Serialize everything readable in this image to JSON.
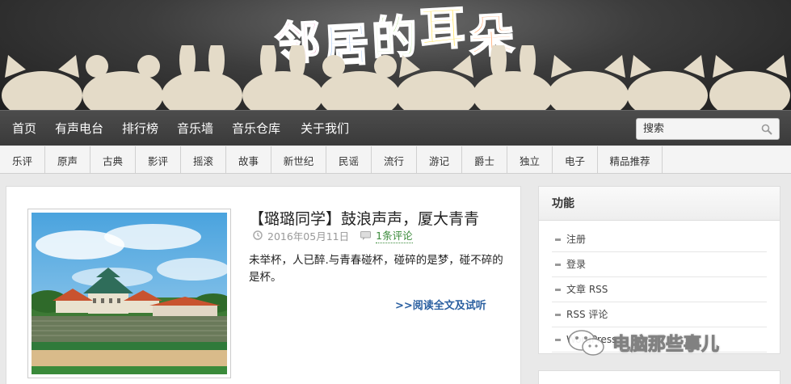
{
  "site": {
    "logo_text": "邻居的耳朵"
  },
  "nav": {
    "items": [
      {
        "label": "首页"
      },
      {
        "label": "有声电台"
      },
      {
        "label": "排行榜"
      },
      {
        "label": "音乐墙"
      },
      {
        "label": "音乐仓库"
      },
      {
        "label": "关于我们"
      }
    ],
    "search_placeholder": "搜索"
  },
  "categories": [
    "乐评",
    "原声",
    "古典",
    "影评",
    "摇滚",
    "故事",
    "新世纪",
    "民谣",
    "流行",
    "游记",
    "爵士",
    "独立",
    "电子",
    "精品推荐"
  ],
  "post": {
    "title": "【璐璐同学】鼓浪声声，厦大青青",
    "date": "2016年05月11日",
    "comments": "1条评论",
    "excerpt": "未举杯，人已醉.与青春碰杯，碰碎的是梦，碰不碎的是杯。",
    "read_more": ">>阅读全文及试听"
  },
  "sidebar": {
    "title": "功能",
    "items": [
      "注册",
      "登录",
      "文章 RSS",
      "RSS 评论",
      "WordPress"
    ]
  },
  "watermark": {
    "text": "电脑那些事儿"
  },
  "colors": {
    "header_bg": "#3c3c3c",
    "nav_bg": "#444444",
    "link_blue": "#2a5fa0",
    "comment_green": "#3a8a3a"
  }
}
